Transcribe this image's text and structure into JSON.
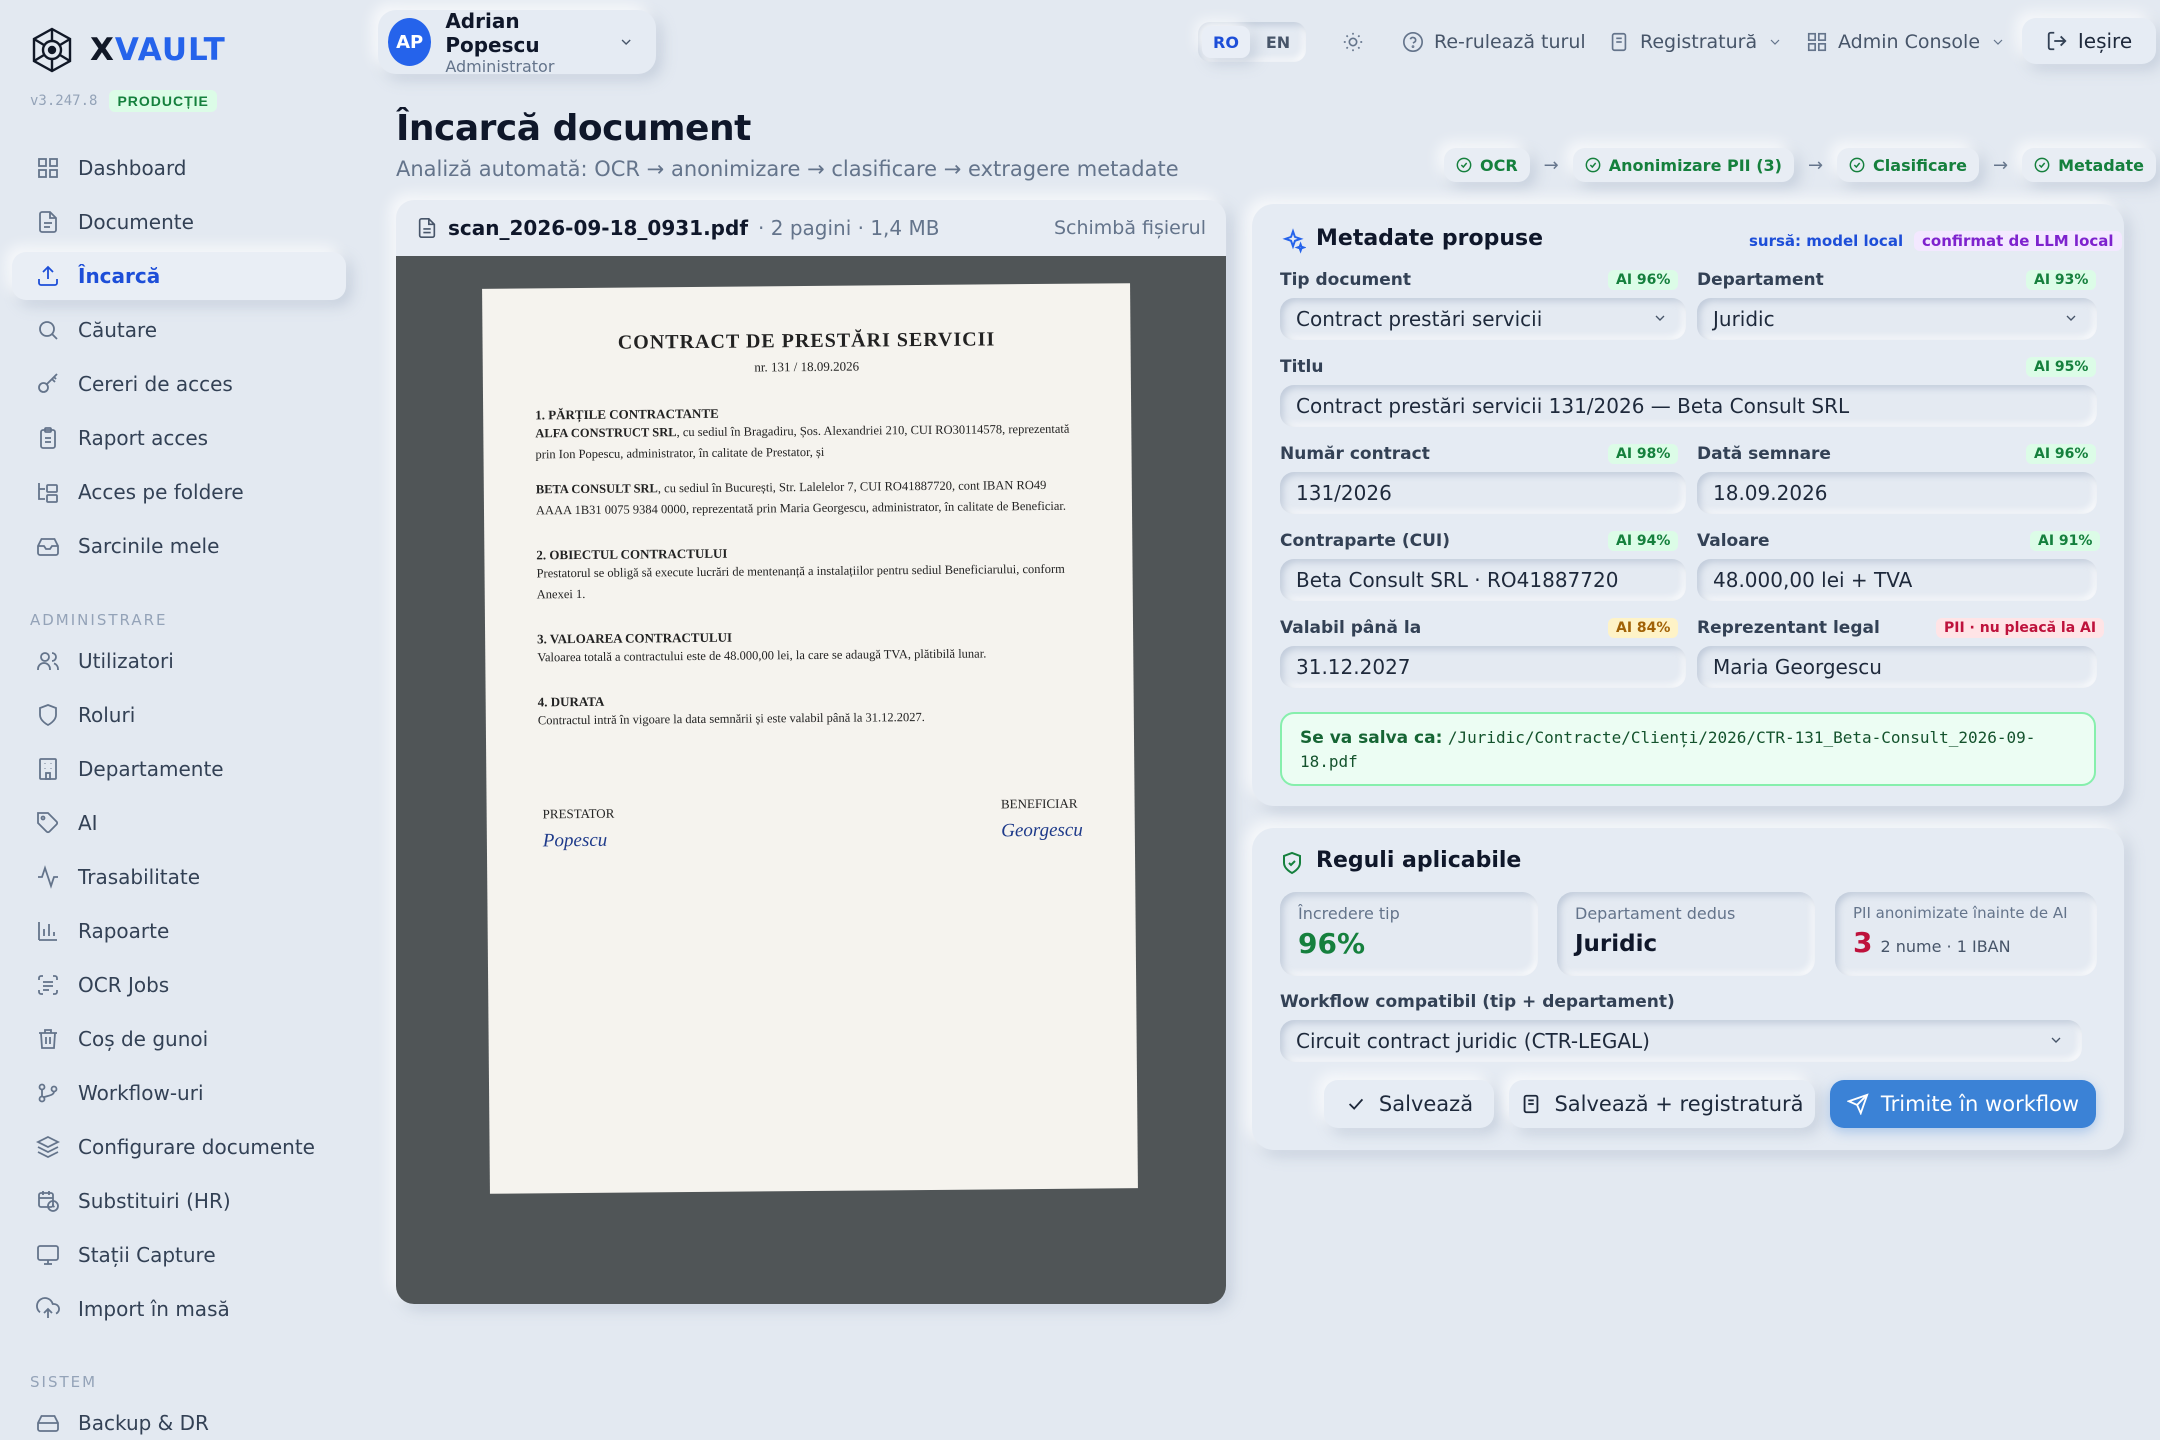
{
  "app": {
    "name_prefix": "X",
    "name_suffix": "VAULT",
    "version": "v3.247.8",
    "env": "PRODUCȚIE"
  },
  "sidebar": {
    "main": [
      {
        "label": "Dashboard",
        "icon": "grid-icon"
      },
      {
        "label": "Documente",
        "icon": "file-icon"
      },
      {
        "label": "Încarcă",
        "icon": "upload-icon",
        "active": true
      },
      {
        "label": "Căutare",
        "icon": "search-icon"
      },
      {
        "label": "Cereri de acces",
        "icon": "key-icon"
      },
      {
        "label": "Raport acces",
        "icon": "clipboard-icon"
      },
      {
        "label": "Acces pe foldere",
        "icon": "folder-tree-icon"
      },
      {
        "label": "Sarcinile mele",
        "icon": "inbox-icon"
      }
    ],
    "admin_title": "ADMINISTRARE",
    "admin": [
      {
        "label": "Utilizatori",
        "icon": "users-icon"
      },
      {
        "label": "Roluri",
        "icon": "shield-icon"
      },
      {
        "label": "Departamente",
        "icon": "building-icon"
      },
      {
        "label": "AI",
        "icon": "tag-icon"
      },
      {
        "label": "Trasabilitate",
        "icon": "activity-icon"
      },
      {
        "label": "Rapoarte",
        "icon": "bar-chart-icon"
      },
      {
        "label": "OCR Jobs",
        "icon": "scan-text-icon"
      },
      {
        "label": "Coș de gunoi",
        "icon": "trash-icon"
      },
      {
        "label": "Workflow-uri",
        "icon": "git-branch-icon"
      },
      {
        "label": "Configurare documente",
        "icon": "layers-icon"
      },
      {
        "label": "Substituiri (HR)",
        "icon": "calendar-clock-icon"
      },
      {
        "label": "Stații Capture",
        "icon": "monitor-icon"
      },
      {
        "label": "Import în masă",
        "icon": "cloud-upload-icon"
      }
    ],
    "system_title": "SISTEM",
    "system": [
      {
        "label": "Backup & DR",
        "icon": "hard-drive-icon"
      }
    ]
  },
  "user": {
    "initials": "AP",
    "name": "Adrian Popescu",
    "role": "Administrator"
  },
  "topbar": {
    "lang": [
      "RO",
      "EN"
    ],
    "rerun": "Re-rulează turul",
    "registry": "Registratură",
    "admin_console": "Admin Console",
    "logout": "Ieșire"
  },
  "page": {
    "title": "Încarcă document",
    "subtitle": "Analiză automată: OCR → anonimizare → clasificare → extragere metadate"
  },
  "pipeline": [
    "OCR",
    "Anonimizare PII (3)",
    "Clasificare",
    "Metadate"
  ],
  "viewer": {
    "filename": "scan_2026-09-18_0931.pdf",
    "meta": "· 2 pagini · 1,4 MB",
    "change": "Schimbă fișierul",
    "doc": {
      "title": "CONTRACT DE PRESTĂRI SERVICII",
      "nr": "nr. 131 / 18.09.2026",
      "s1": "1. PĂRȚILE CONTRACTANTE",
      "p1a": "ALFA CONSTRUCT SRL",
      "p1b": ", cu sediul în Bragadiru, Șos. Alexandriei 210, CUI RO30114578, reprezentată prin Ion Popescu, administrator, în calitate de Prestator, și",
      "p2a": "BETA CONSULT SRL",
      "p2b": ", cu sediul în București, Str. Lalelelor 7, CUI RO41887720, cont IBAN RO49 AAAA 1B31 0075 9384 0000, reprezentată prin Maria Georgescu, administrator, în calitate de Beneficiar.",
      "s2": "2. OBIECTUL CONTRACTULUI",
      "p3": "Prestatorul se obligă să execute lucrări de mentenanță a instalațiilor pentru sediul Beneficiarului, conform Anexei 1.",
      "s3": "3. VALOAREA CONTRACTULUI",
      "p4": "Valoarea totală a contractului este de 48.000,00 lei, la care se adaugă TVA, plătibilă lunar.",
      "s4": "4. DURATA",
      "p5": "Contractul intră în vigoare la data semnării și este valabil până la 31.12.2027.",
      "sig_left_title": "PRESTATOR",
      "sig_left_name": "Popescu",
      "sig_right_title": "BENEFICIAR",
      "sig_right_name": "Georgescu"
    }
  },
  "metadata": {
    "title": "Metadate propuse",
    "source": "sursă: model local",
    "confirmed": "confirmat de LLM local",
    "fields": {
      "tip": {
        "label": "Tip document",
        "conf": "AI 96%",
        "value": "Contract prestări servicii"
      },
      "dept": {
        "label": "Departament",
        "conf": "AI 93%",
        "value": "Juridic"
      },
      "titlu": {
        "label": "Titlu",
        "conf": "AI 95%",
        "value": "Contract prestări servicii 131/2026 — Beta Consult SRL"
      },
      "nr": {
        "label": "Număr contract",
        "conf": "AI 98%",
        "value": "131/2026"
      },
      "data": {
        "label": "Dată semnare",
        "conf": "AI 96%",
        "value": "18.09.2026"
      },
      "contra": {
        "label": "Contraparte (CUI)",
        "conf": "AI 94%",
        "value": "Beta Consult SRL · RO41887720"
      },
      "valoare": {
        "label": "Valoare",
        "conf": "AI 91%",
        "value": "48.000,00 lei + TVA"
      },
      "valabil": {
        "label": "Valabil până la",
        "conf": "AI 84%",
        "value": "31.12.2027"
      },
      "repr": {
        "label": "Reprezentant legal",
        "conf": "PII · nu pleacă la AI",
        "value": "Maria Georgescu"
      }
    },
    "save_label": "Se va salva ca:",
    "save_path": "/Juridic/Contracte/Clienți/2026/CTR-131_Beta-Consult_2026-09-18.pdf"
  },
  "rules": {
    "title": "Reguli aplicabile",
    "stats": [
      {
        "label": "Încredere tip",
        "value": "96%"
      },
      {
        "label": "Departament dedus",
        "value": "Juridic"
      },
      {
        "label": "PII anonimizate înainte de AI",
        "value": "3",
        "detail": "2 nume · 1 IBAN"
      }
    ],
    "workflow_label": "Workflow compatibil (tip + departament)",
    "workflow_value": "Circuit contract juridic (CTR-LEGAL)",
    "buttons": {
      "save": "Salvează",
      "save_reg": "Salvează + registratură",
      "send": "Trimite în workflow"
    }
  },
  "colors": {
    "accent": "#2563eb",
    "success": "#15803d",
    "danger": "#be123c",
    "warn": "#a16207"
  }
}
